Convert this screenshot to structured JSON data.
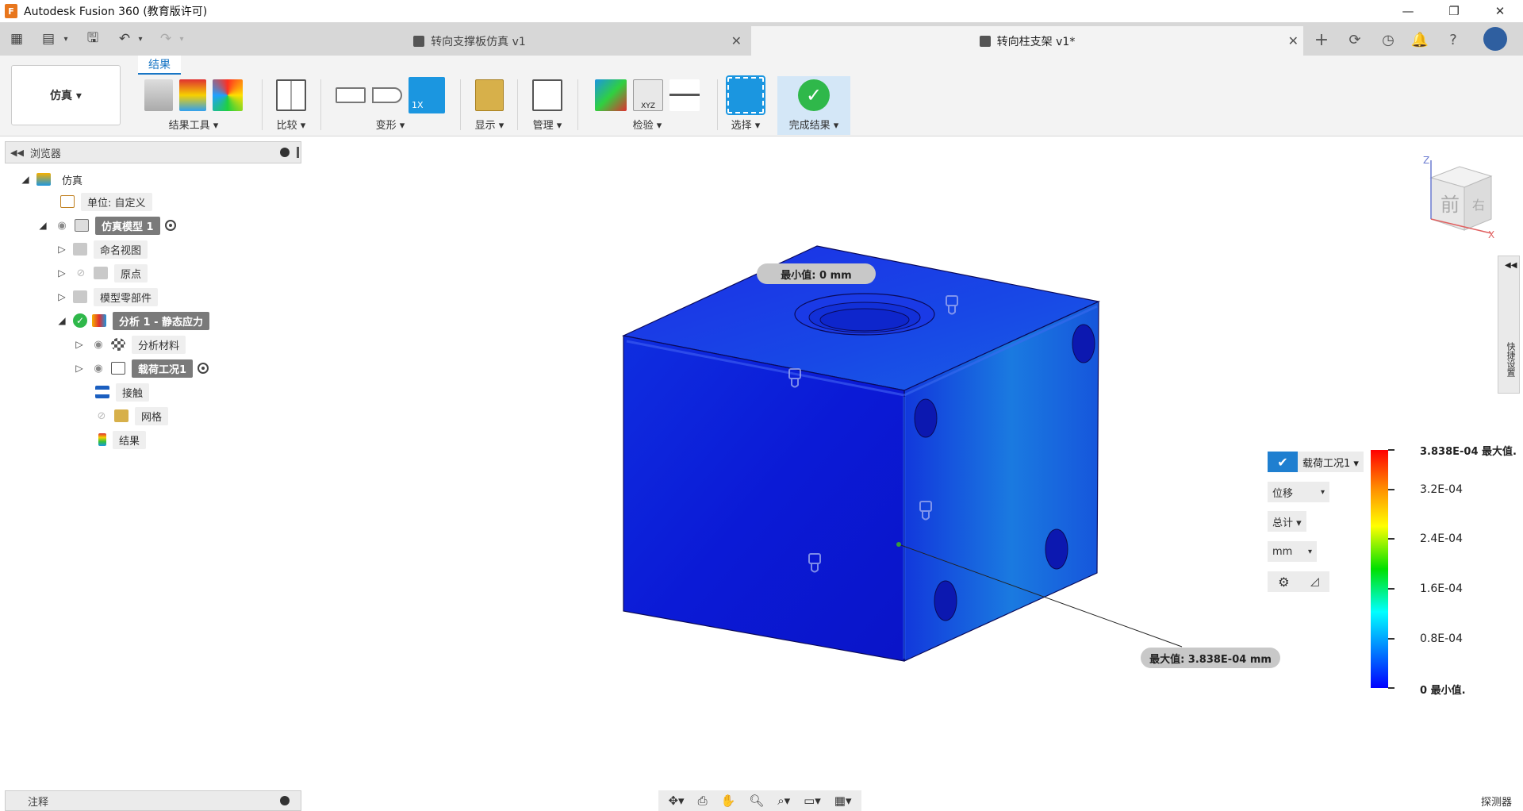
{
  "window": {
    "title": "Autodesk Fusion 360 (教育版许可)",
    "logo_letter": "F"
  },
  "tabs": [
    {
      "label": "转向支撑板仿真 v1",
      "active": false
    },
    {
      "label": "转向柱支架 v1*",
      "active": true
    }
  ],
  "toolbar": {
    "workspace": "仿真 ▾",
    "ribbon_tab": "结果",
    "groups": {
      "result_tools": "结果工具 ▾",
      "compare": "比较 ▾",
      "deform": "变形 ▾",
      "display": "显示 ▾",
      "manage": "管理 ▾",
      "inspect": "检验 ▾",
      "select": "选择 ▾",
      "finish": "完成结果 ▾"
    },
    "deform_scale_label": "1X",
    "inspect_xyz_label": "XYZ"
  },
  "browser": {
    "title": "浏览器",
    "nodes": {
      "root": "仿真",
      "units": "单位: 自定义",
      "model": "仿真模型 1",
      "named_views": "命名视图",
      "origin": "原点",
      "model_components": "模型零部件",
      "study": "分析 1 - 静态应力",
      "study_materials": "分析材料",
      "load_case": "载荷工况1",
      "contacts": "接触",
      "mesh": "网格",
      "results": "结果"
    }
  },
  "viewport": {
    "min_probe": "最小值: 0 mm",
    "max_probe": "最大值: 3.838E-04 mm",
    "viewcube": {
      "front": "前",
      "right": "右",
      "z": "Z",
      "x": "X"
    },
    "colors": {
      "top_face": "#1a3fe0",
      "front_face": "#0d1fd8",
      "right_face": "#1768e0"
    }
  },
  "legend": {
    "load_case": "载荷工况1 ▾",
    "result_type": "位移",
    "component": "总计 ▾",
    "unit": "mm",
    "labels": [
      "3.838E-04 最大值.",
      "3.2E-04",
      "2.4E-04",
      "1.6E-04",
      "0.8E-04",
      "0 最小值."
    ],
    "max": 0.0003838,
    "min": 0
  },
  "side_panel": {
    "label": "快捷设置"
  },
  "bottom": {
    "notes": "注释",
    "detector": "探测器"
  }
}
